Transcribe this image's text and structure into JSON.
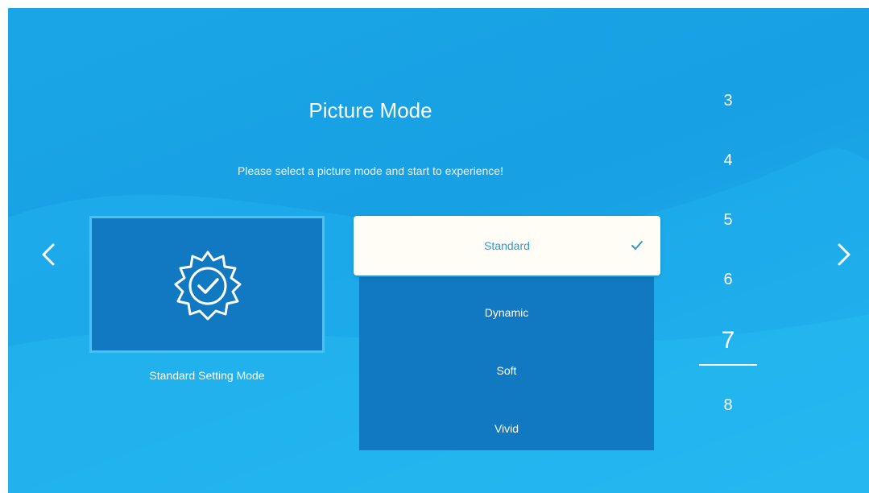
{
  "title": "Picture Mode",
  "subtitle": "Please select a picture mode and start to experience!",
  "preview": {
    "caption": "Standard Setting Mode",
    "icon": "badge-check-icon"
  },
  "modes": {
    "selected": "Standard",
    "items": [
      "Dynamic",
      "Soft",
      "Vivid"
    ]
  },
  "picker": {
    "numbers": [
      "3",
      "4",
      "5",
      "6",
      "7",
      "8"
    ],
    "active": "7"
  },
  "colors": {
    "background": "#1aa6e6",
    "panel": "#1179c2",
    "selected_bg": "#fffdf6",
    "accent": "#2f98d7"
  }
}
